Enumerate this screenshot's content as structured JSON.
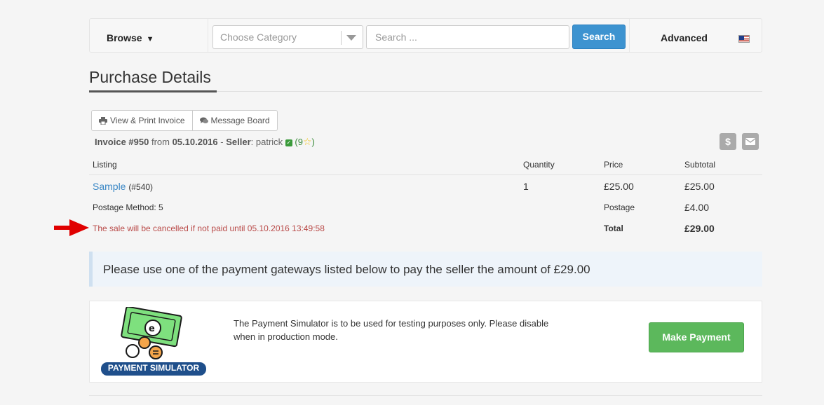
{
  "topbar": {
    "browse_label": "Browse",
    "category_placeholder": "Choose Category",
    "search_placeholder": "Search ...",
    "search_button": "Search",
    "advanced_label": "Advanced",
    "flag_icon": "us-flag-icon"
  },
  "page": {
    "title": "Purchase Details"
  },
  "buttons": {
    "view_print": "View & Print Invoice",
    "message_board": "Message Board"
  },
  "invoice": {
    "label": "Invoice #950",
    "from_word": "from",
    "date": "05.10.2016",
    "seller_label": "Seller",
    "seller_name": "patrick",
    "feedback_open": "(9",
    "feedback_close": ")"
  },
  "table": {
    "headers": [
      "Listing",
      "Quantity",
      "Price",
      "Subtotal"
    ],
    "item": {
      "name": "Sample",
      "id": "(#540)",
      "quantity": "1",
      "price": "£25.00",
      "subtotal": "£25.00"
    },
    "postage": {
      "method": "Postage Method: 5",
      "label": "Postage",
      "amount": "£4.00"
    },
    "total": {
      "warning": "The sale will be cancelled if not paid until 05.10.2016 13:49:58",
      "label": "Total",
      "amount": "£29.00"
    }
  },
  "alert": {
    "text": "Please use one of the payment gateways listed below to pay the seller the amount of £29.00"
  },
  "payment": {
    "logo_label": "PAYMENT SIMULATOR",
    "description": "The Payment Simulator is to be used for testing purposes only. Please disable when in production mode.",
    "button": "Make Payment"
  },
  "colors": {
    "accent": "#3d93d0",
    "success": "#5cb85c",
    "warning_red": "#b94a48",
    "arrow_red": "#e00000"
  }
}
